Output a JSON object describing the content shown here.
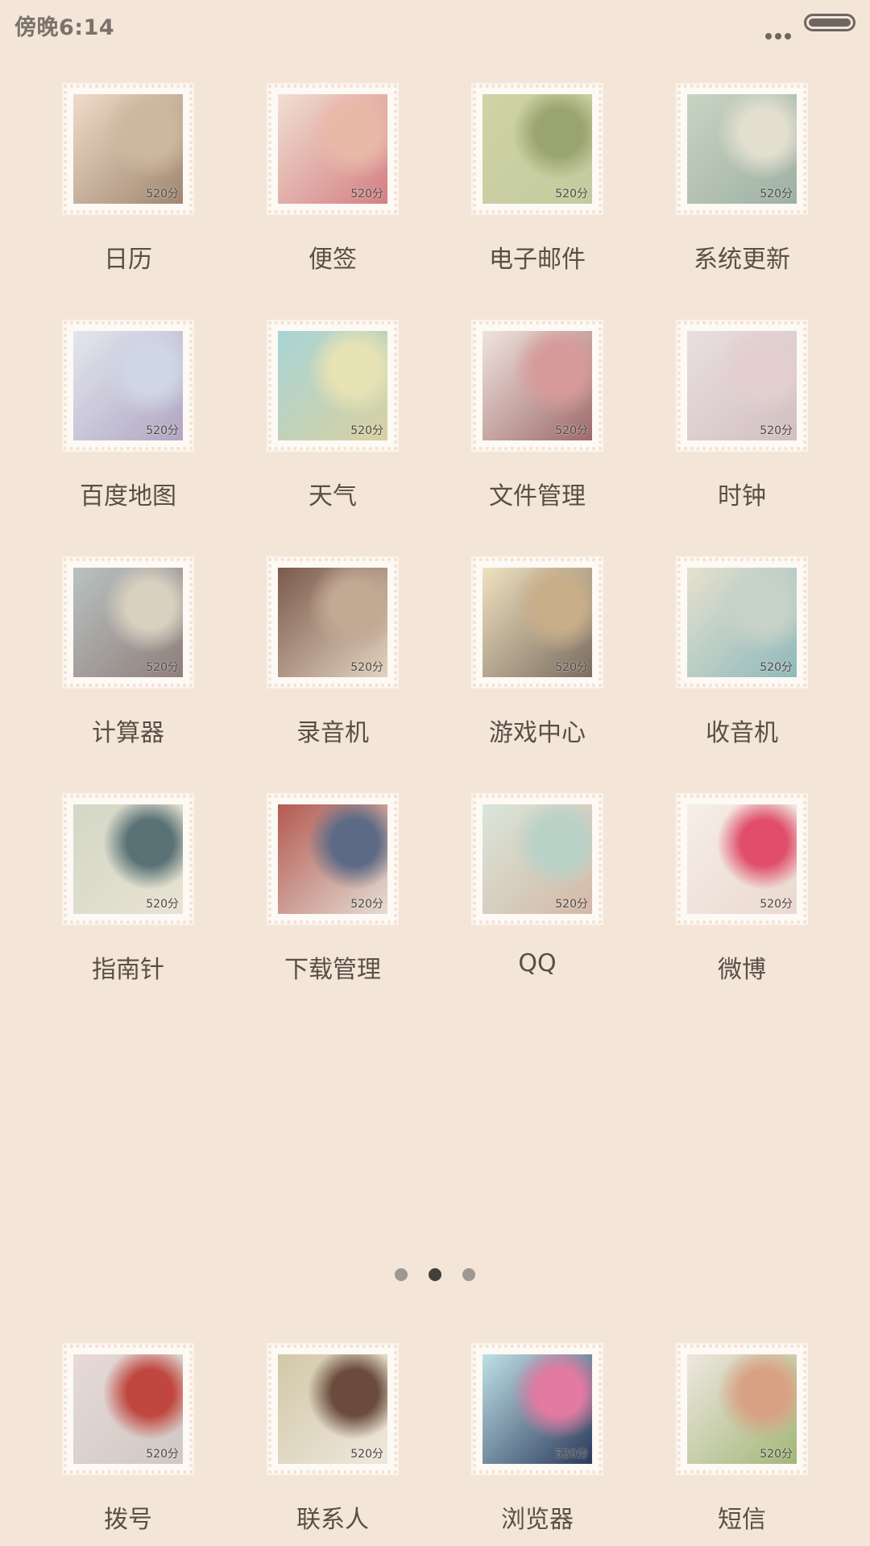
{
  "status_bar": {
    "time": "傍晚6:14"
  },
  "apps": [
    {
      "label": "日历",
      "score": "520分",
      "colors": [
        "#efdcc8",
        "#cdb79e",
        "#a08670"
      ]
    },
    {
      "label": "便签",
      "score": "520分",
      "colors": [
        "#f0e0d2",
        "#e9b9a8",
        "#d47e82"
      ]
    },
    {
      "label": "电子邮件",
      "score": "520分",
      "colors": [
        "#cfd3a4",
        "#9aa46f",
        "#c2cba0"
      ]
    },
    {
      "label": "系统更新",
      "score": "520分",
      "colors": [
        "#c9d4c3",
        "#e2dfcf",
        "#9eb0a2"
      ]
    },
    {
      "label": "百度地图",
      "score": "520分",
      "colors": [
        "#e3e7ee",
        "#cfd6e4",
        "#b0a6c3"
      ]
    },
    {
      "label": "天气",
      "score": "520分",
      "colors": [
        "#a8d4d6",
        "#e8e3b5",
        "#d9d1a0"
      ]
    },
    {
      "label": "文件管理",
      "score": "520分",
      "colors": [
        "#efe4de",
        "#d79a9a",
        "#9e6a6a"
      ]
    },
    {
      "label": "时钟",
      "score": "520分",
      "colors": [
        "#eadfe0",
        "#e3cfcf",
        "#d1bfc0"
      ]
    },
    {
      "label": "计算器",
      "score": "520分",
      "colors": [
        "#b9c2c2",
        "#d8d1c0",
        "#8f7e7a"
      ]
    },
    {
      "label": "录音机",
      "score": "520分",
      "colors": [
        "#7b5a4b",
        "#c2a993",
        "#e3d3c0"
      ]
    },
    {
      "label": "游戏中心",
      "score": "520分",
      "colors": [
        "#efe2bf",
        "#c9ae8a",
        "#7a6c60"
      ]
    },
    {
      "label": "收音机",
      "score": "520分",
      "colors": [
        "#e6e1cf",
        "#c7d2c8",
        "#8fb9bb"
      ]
    },
    {
      "label": "指南针",
      "score": "520分",
      "colors": [
        "#d4d7c6",
        "#5a7276",
        "#e8e3d2"
      ]
    },
    {
      "label": "下载管理",
      "score": "520分",
      "colors": [
        "#b45a52",
        "#5c6a86",
        "#e4ddd3"
      ]
    },
    {
      "label": "QQ",
      "score": "520分",
      "colors": [
        "#d9e6da",
        "#b9d2c7",
        "#d4b8a6"
      ]
    },
    {
      "label": "微博",
      "score": "520分",
      "colors": [
        "#f6eee8",
        "#e04e6a",
        "#ead9cf"
      ]
    }
  ],
  "pager": {
    "count": 3,
    "active": 1
  },
  "dock": [
    {
      "label": "拨号",
      "score": "520分",
      "colors": [
        "#e7dad7",
        "#c0473f",
        "#cfc8c3"
      ]
    },
    {
      "label": "联系人",
      "score": "520分",
      "colors": [
        "#d2c8a8",
        "#6b4b3c",
        "#efe8de"
      ]
    },
    {
      "label": "浏览器",
      "score": "520分",
      "colors": [
        "#bfe0e6",
        "#e37aa2",
        "#2a3a5b"
      ]
    },
    {
      "label": "短信",
      "score": "520分",
      "colors": [
        "#eee7e0",
        "#d9a184",
        "#a2b777"
      ]
    }
  ]
}
